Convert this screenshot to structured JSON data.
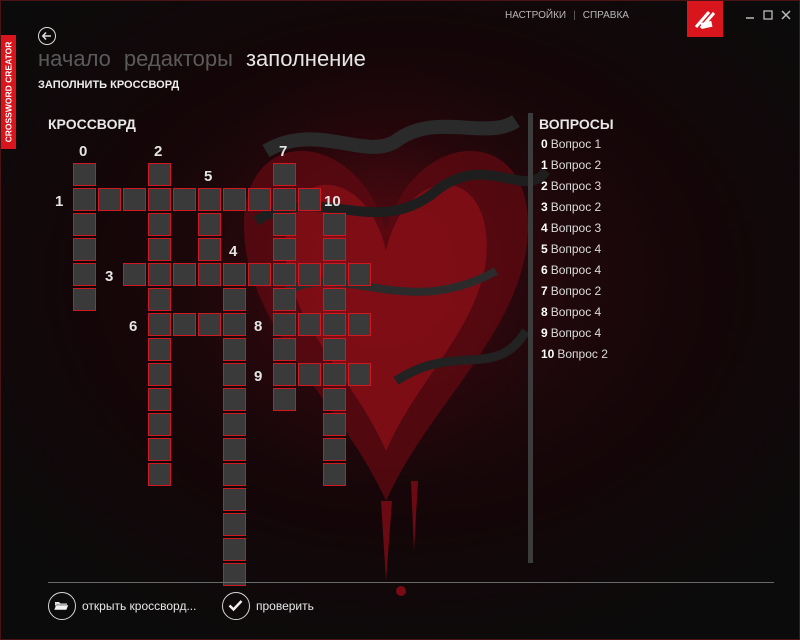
{
  "app": {
    "side_tab": "CROSSWORD CREATOR"
  },
  "top_links": {
    "settings": "НАСТРОЙКИ",
    "separator": "|",
    "help": "СПРАВКА"
  },
  "nav": {
    "tabs": [
      {
        "label": "начало",
        "active": false
      },
      {
        "label": "редакторы",
        "active": false
      },
      {
        "label": "заполнение",
        "active": true
      }
    ],
    "subtitle": "ЗАПОЛНИТЬ КРОССВОРД"
  },
  "crossword": {
    "title": "КРОССВОРД",
    "numbers": [
      "0",
      "1",
      "2",
      "3",
      "4",
      "5",
      "6",
      "7",
      "8",
      "9",
      "10"
    ]
  },
  "questions": {
    "title": "ВОПРОСЫ",
    "items": [
      {
        "num": "0",
        "text": "Вопрос 1"
      },
      {
        "num": "1",
        "text": "Вопрос 2"
      },
      {
        "num": "2",
        "text": "Вопрос 3"
      },
      {
        "num": "3",
        "text": "Вопрос 2"
      },
      {
        "num": "4",
        "text": "Вопрос 3"
      },
      {
        "num": "5",
        "text": "Вопрос 4"
      },
      {
        "num": "6",
        "text": "Вопрос 4"
      },
      {
        "num": "7",
        "text": "Вопрос 2"
      },
      {
        "num": "8",
        "text": "Вопрос 4"
      },
      {
        "num": "9",
        "text": "Вопрос 4"
      },
      {
        "num": "10",
        "text": "Вопрос 2"
      }
    ]
  },
  "bottom": {
    "open_label": "открыть кроссворд...",
    "check_label": "проверить"
  },
  "colors": {
    "accent": "#d8141c",
    "cell_fill": "#3a3a3a",
    "cell_border": "#d01820"
  },
  "icons": [
    "back-arrow-icon",
    "app-logo-icon",
    "minimize-icon",
    "maximize-icon",
    "close-icon",
    "folder-open-icon",
    "checkmark-icon"
  ]
}
